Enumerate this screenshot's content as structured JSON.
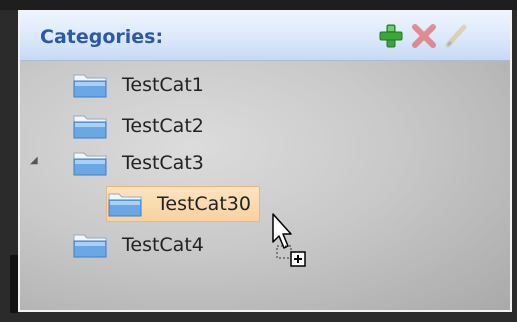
{
  "panel": {
    "title": "Categories:",
    "toolbar": {
      "add_icon": "plus-icon",
      "delete_icon": "x-icon",
      "edit_icon": "pencil-icon"
    }
  },
  "tree": {
    "items": [
      {
        "label": "TestCat1",
        "level": 0
      },
      {
        "label": "TestCat2",
        "level": 0
      },
      {
        "label": "TestCat3",
        "level": 0,
        "expanded": true
      },
      {
        "label": "TestCat30",
        "level": 1,
        "selected": true
      },
      {
        "label": "TestCat4",
        "level": 0
      }
    ]
  },
  "colors": {
    "title": "#2b5aa8",
    "selection": "#f8d2a0",
    "add": "#3aa63a",
    "delete": "#e04040"
  }
}
